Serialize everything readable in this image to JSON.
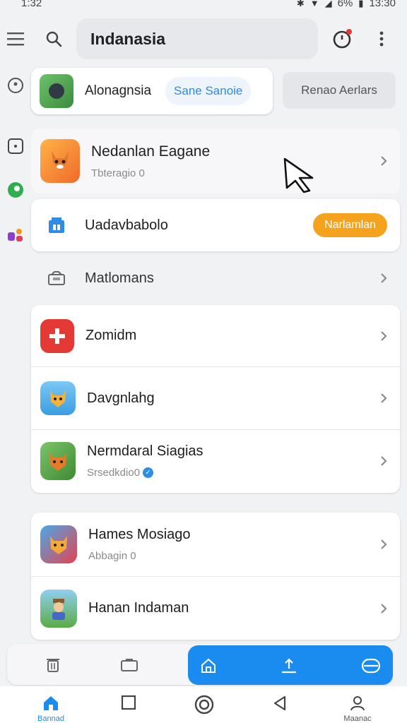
{
  "status_bar": {
    "time": "1:32",
    "battery": "6%",
    "clock_right": "13:30"
  },
  "search": {
    "query": "Indanasia"
  },
  "chip_bar": {
    "label": "Alonagnsia",
    "pill": "Sane Sanoie",
    "secondary": "Renao Aerlars"
  },
  "featured": {
    "title": "Nedanlan Eagane",
    "subtitle": "Tbteragio 0"
  },
  "promo_row": {
    "title": "Uadavbabolo",
    "button": "Narlamlan"
  },
  "plain_row": {
    "title": "Matlomans"
  },
  "group1": [
    {
      "title": "Zomidm"
    },
    {
      "title": "Davgnlahg"
    },
    {
      "title": "Nermdaral Siagias",
      "subtitle": "Srsedkdio0"
    }
  ],
  "group2": [
    {
      "title": "Hames Mosiago",
      "subtitle": "Abbagin 0"
    },
    {
      "title": "Hanan Indaman"
    }
  ],
  "nav": {
    "home_label": "Bannad",
    "profile_label": "Maanac"
  },
  "colors": {
    "accent_blue": "#1a8cf0",
    "orange": "#f5a31d",
    "red": "#e53935"
  }
}
